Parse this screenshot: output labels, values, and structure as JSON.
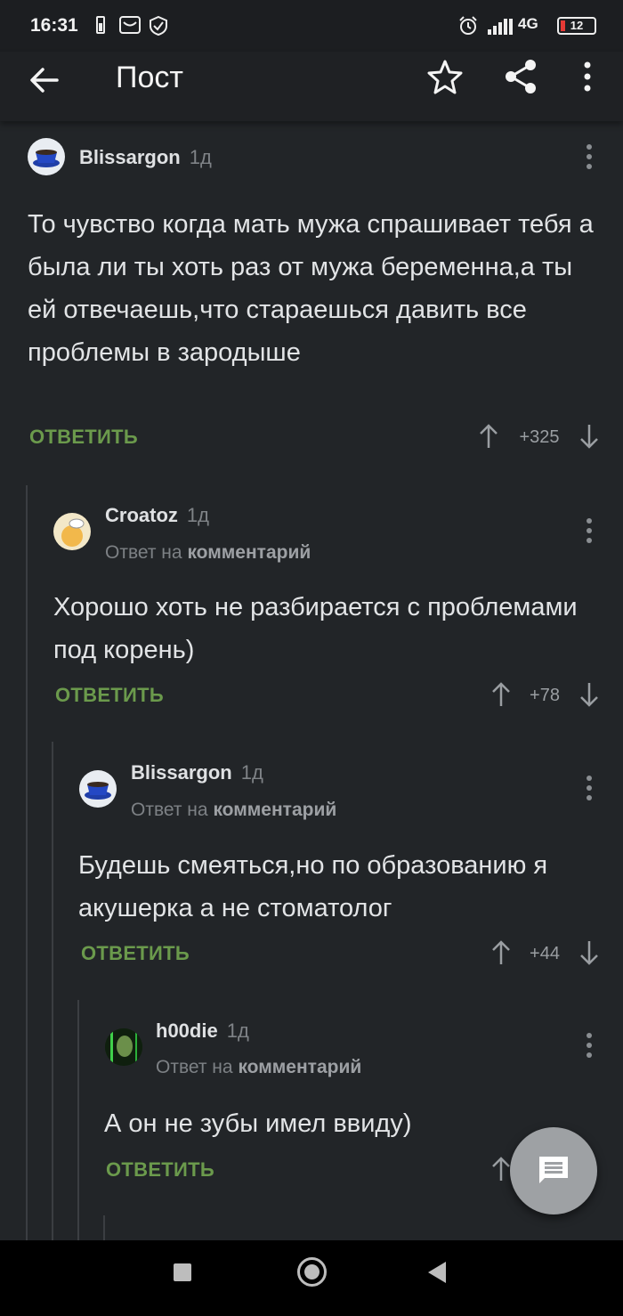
{
  "status_bar": {
    "time": "16:31",
    "network": "4G",
    "battery": "12"
  },
  "app_bar": {
    "title": "Пост"
  },
  "comments": [
    {
      "author": "Blissargon",
      "age": "1д",
      "text": "То чувство когда мать мужа спрашивает тебя а была ли ты хоть раз от мужа беременна,а ты ей отвечаешь,что стараешься давить все проблемы в зародыше",
      "reply": "ОТВЕТИТЬ",
      "score": "+325"
    },
    {
      "author": "Croatoz",
      "age": "1д",
      "reply_prefix": "Ответ на",
      "reply_target": "комментарий",
      "text": "Хорошо хоть не разбирается с проблемами под корень)",
      "reply": "ОТВЕТИТЬ",
      "score": "+78"
    },
    {
      "author": "Blissargon",
      "age": "1д",
      "reply_prefix": "Ответ на",
      "reply_target": "комментарий",
      "text": "Будешь смеяться,но по образованию я акушерка а не стоматолог",
      "reply": "ОТВЕТИТЬ",
      "score": "+44"
    },
    {
      "author": "h00die",
      "age": "1д",
      "reply_prefix": "Ответ на",
      "reply_target": "комментарий",
      "text": "А он не зубы имел ввиду)",
      "reply": "ОТВЕТИТЬ"
    }
  ],
  "icons": {
    "back": "arrow-left-icon",
    "favorite": "star-outline-icon",
    "share": "share-icon",
    "more": "more-vertical-icon",
    "fab": "comment-icon"
  },
  "colors": {
    "background": "#222528",
    "reply_accent": "#6b9a4c",
    "fab": "#9ea1a4"
  }
}
